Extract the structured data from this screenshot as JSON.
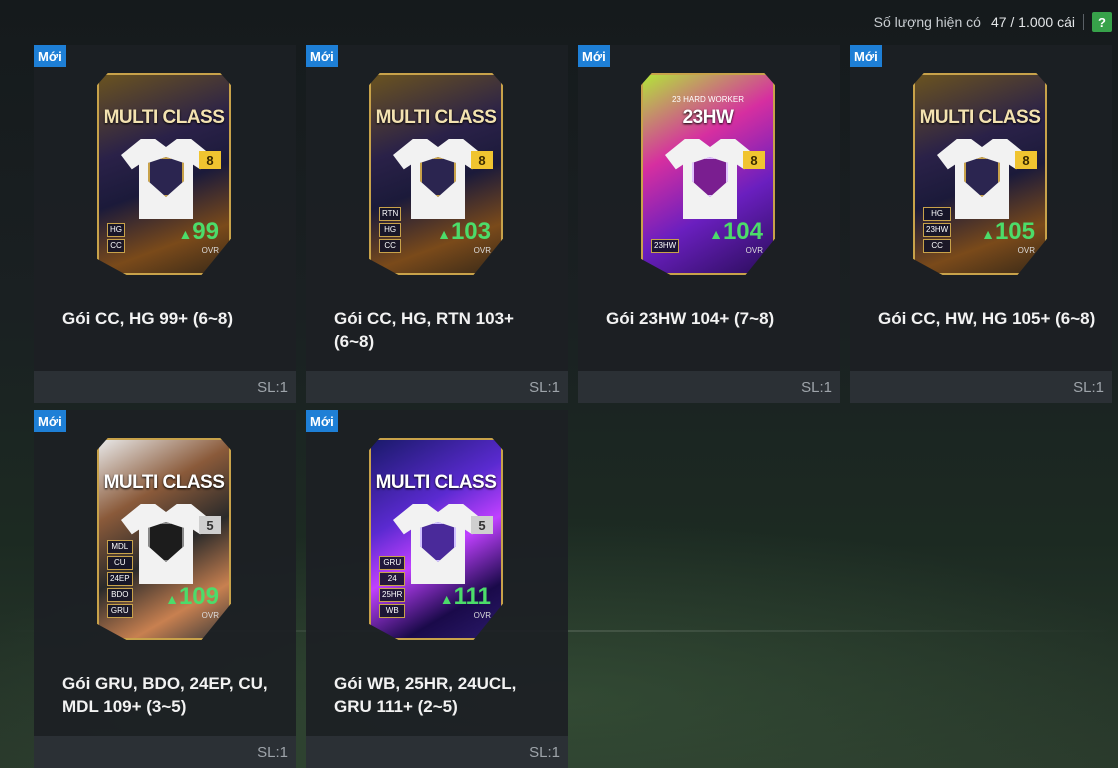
{
  "header": {
    "count_label": "Số lượng hiện có",
    "count_value": "47 / 1.000 cái",
    "help_label": "?"
  },
  "badge_new": "Mới",
  "ovr_label": "OVR",
  "packs": [
    {
      "name": "Gói CC, HG 99+ (6~8)",
      "qty": "SL:1",
      "card_title": "MULTI CLASS",
      "card_sub": "",
      "level": "8",
      "ovr": "99",
      "tags": [
        "HG",
        "CC"
      ]
    },
    {
      "name": "Gói CC, HG, RTN 103+ (6~8)",
      "qty": "SL:1",
      "card_title": "MULTI CLASS",
      "card_sub": "",
      "level": "8",
      "ovr": "103",
      "tags": [
        "RTN",
        "HG",
        "CC"
      ]
    },
    {
      "name": "Gói 23HW 104+ (7~8)",
      "qty": "SL:1",
      "card_title": "23HW",
      "card_sub": "23 HARD WORKER",
      "level": "8",
      "ovr": "104",
      "tags": [
        "23HW"
      ]
    },
    {
      "name": "Gói CC, HW, HG 105+ (6~8)",
      "qty": "SL:1",
      "card_title": "MULTI CLASS",
      "card_sub": "",
      "level": "8",
      "ovr": "105",
      "tags": [
        "HG",
        "23HW",
        "CC"
      ]
    },
    {
      "name": "Gói GRU, BDO, 24EP, CU, MDL 109+ (3~5)",
      "qty": "SL:1",
      "card_title": "MULTI CLASS",
      "card_sub": "",
      "level": "5",
      "ovr": "109",
      "tags": [
        "MDL",
        "CU",
        "24EP",
        "BDO",
        "GRU"
      ]
    },
    {
      "name": "Gói WB, 25HR, 24UCL, GRU 111+ (2~5)",
      "qty": "SL:1",
      "card_title": "MULTI CLASS",
      "card_sub": "",
      "level": "5",
      "ovr": "111",
      "tags": [
        "GRU",
        "24",
        "25HR",
        "WB"
      ]
    }
  ]
}
